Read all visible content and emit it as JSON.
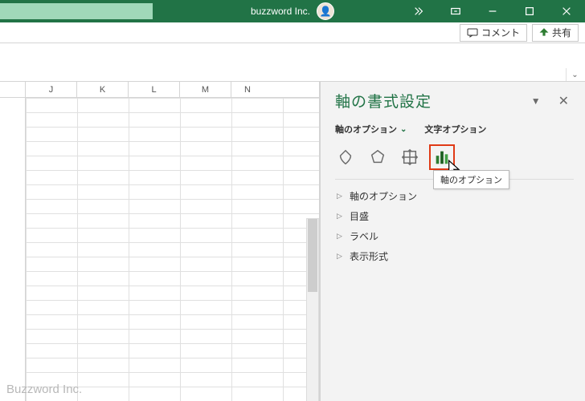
{
  "titlebar": {
    "app_title": "buzzword Inc.",
    "avatar_glyph": "👤"
  },
  "ribbon": {
    "comment": "コメント",
    "share": "共有"
  },
  "columns": [
    "J",
    "K",
    "L",
    "M",
    "N"
  ],
  "pane": {
    "title": "軸の書式設定",
    "tabs": {
      "axis": "軸のオプション",
      "text": "文字オプション"
    },
    "tooltip": "軸のオプション",
    "sections": {
      "axis_options": "軸のオプション",
      "tick_marks": "目盛",
      "labels": "ラベル",
      "number": "表示形式"
    }
  },
  "watermark": "Buzzword Inc."
}
